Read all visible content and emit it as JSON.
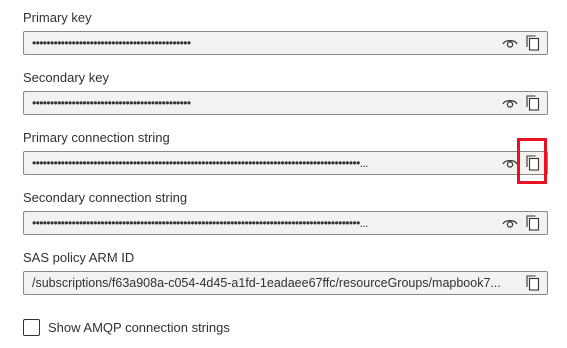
{
  "fields": [
    {
      "label": "Primary key",
      "value": "••••••••••••••••••••••••••••••••••••••••••••",
      "masked": true,
      "eye_icon": "eye-icon",
      "copy_icon": "copy-icon"
    },
    {
      "label": "Secondary key",
      "value": "••••••••••••••••••••••••••••••••••••••••••••",
      "masked": true,
      "eye_icon": "eye-icon",
      "copy_icon": "copy-icon"
    },
    {
      "label": "Primary connection string",
      "value": "•••••••••••••••••••••••••••••••••••••••••••••••••••••••••••••••••••••••••••••••••••••••••••...",
      "masked": true,
      "eye_icon": "eye-icon",
      "copy_icon": "copy-icon"
    },
    {
      "label": "Secondary connection string",
      "value": "•••••••••••••••••••••••••••••••••••••••••••••••••••••••••••••••••••••••••••••••••••••••••••...",
      "masked": true,
      "eye_icon": "eye-icon",
      "copy_icon": "copy-icon"
    },
    {
      "label": "SAS policy ARM ID",
      "value": "/subscriptions/f63a908a-c054-4d45-a1fd-1eadaee67ffc/resourceGroups/mapbook7...",
      "masked": false,
      "copy_icon": "copy-icon"
    }
  ],
  "checkbox": {
    "label": "Show AMQP connection strings",
    "checked": false
  },
  "highlight_color": "#e81123"
}
